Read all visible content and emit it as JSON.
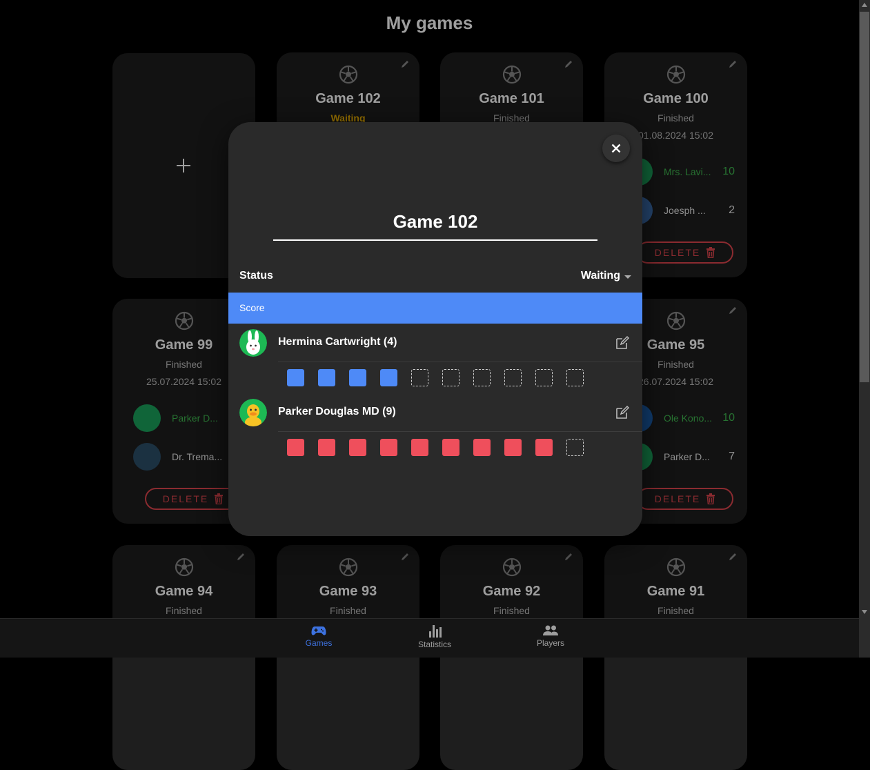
{
  "page": {
    "title": "My games"
  },
  "cards": [
    {
      "name": "Game 102",
      "status": "Waiting",
      "status_type": "waiting"
    },
    {
      "name": "Game 101",
      "status": "Finished"
    },
    {
      "name": "Game 100",
      "status": "Finished",
      "date": "01.08.2024 15:02",
      "players": [
        {
          "name": "Mrs. Lavi...",
          "score": "10",
          "winner": true
        },
        {
          "name": "Joesph ...",
          "score": "2",
          "winner": false
        }
      ],
      "delete_label": "DELETE"
    },
    {
      "name": "Game 99",
      "status": "Finished",
      "date": "25.07.2024 15:02",
      "players": [
        {
          "name": "Parker D...",
          "score": "",
          "winner": true
        },
        {
          "name": "Dr. Trema...",
          "score": "",
          "winner": false
        }
      ],
      "delete_label": "DELETE"
    },
    {
      "name": "Game 95",
      "status": "Finished",
      "date": "26.07.2024 15:02",
      "players": [
        {
          "name": "Ole Kono...",
          "score": "10",
          "winner": true
        },
        {
          "name": "Parker D...",
          "score": "7",
          "winner": false
        }
      ],
      "delete_label": "DELETE"
    },
    {
      "name": "Game 94",
      "status": "Finished"
    },
    {
      "name": "Game 93",
      "status": "Finished"
    },
    {
      "name": "Game 92",
      "status": "Finished"
    },
    {
      "name": "Game 91",
      "status": "Finished"
    }
  ],
  "nav": [
    {
      "label": "Games",
      "icon": "gamepad-icon",
      "active": true
    },
    {
      "label": "Statistics",
      "icon": "bar-chart-icon",
      "active": false
    },
    {
      "label": "Players",
      "icon": "people-icon",
      "active": false
    }
  ],
  "modal": {
    "title": "Game 102",
    "status_label": "Status",
    "status_value": "Waiting",
    "score_header": "Score",
    "players": [
      {
        "name": "Hermina Cartwright (4)",
        "score": 4,
        "total": 10,
        "color": "#4e8af7",
        "avatar": "rabbit-avatar"
      },
      {
        "name": "Parker Douglas MD (9)",
        "score": 9,
        "total": 10,
        "color": "#ef4f5c",
        "avatar": "duck-avatar"
      }
    ]
  },
  "colors": {
    "accent": "#4e8af7",
    "win": "#3fb950",
    "danger": "#e0464e",
    "waiting": "#f0b400"
  }
}
